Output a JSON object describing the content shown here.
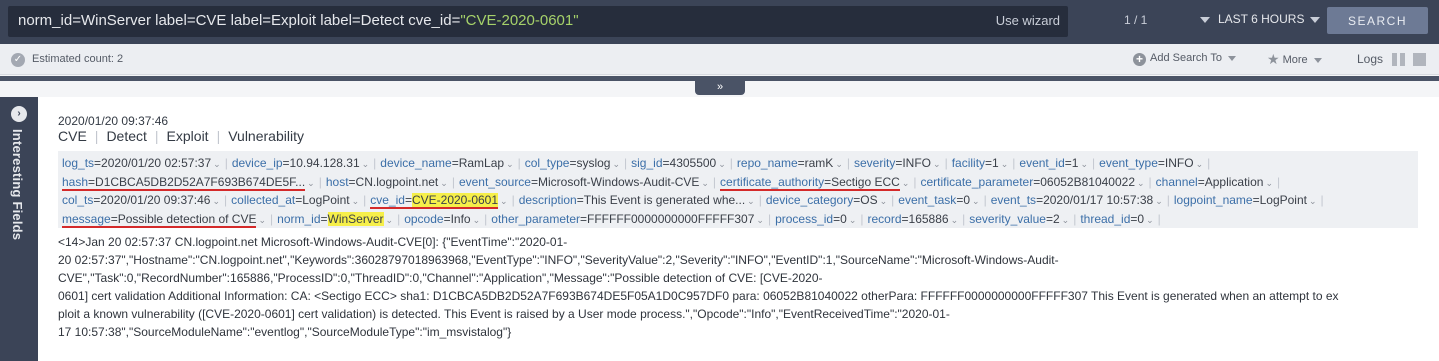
{
  "search": {
    "query_prefix": "norm_id=WinServer label=CVE label=Exploit label=Detect cve_id=",
    "query_value": "\"CVE-2020-0601\"",
    "use_wizard": "Use wizard",
    "pager": "1 / 1",
    "time_range": "LAST 6 HOURS",
    "search_button": "SEARCH"
  },
  "subbar": {
    "estimated": "Estimated count: 2",
    "add_search_to": "Add Search To",
    "more": "More",
    "logs": "Logs"
  },
  "side_panel": {
    "label": "Interesting Fields"
  },
  "entry": {
    "timestamp": "2020/01/20 09:37:46",
    "tags": [
      "CVE",
      "Detect",
      "Exploit",
      "Vulnerability"
    ],
    "fields": [
      [
        {
          "k": "log_ts",
          "v": "2020/01/20 02:57:37"
        },
        {
          "k": "device_ip",
          "v": "10.94.128.31"
        },
        {
          "k": "device_name",
          "v": "RamLap"
        },
        {
          "k": "col_type",
          "v": "syslog"
        },
        {
          "k": "sig_id",
          "v": "4305500"
        },
        {
          "k": "repo_name",
          "v": "ramK"
        },
        {
          "k": "severity",
          "v": "INFO"
        },
        {
          "k": "facility",
          "v": "1"
        },
        {
          "k": "event_id",
          "v": "1"
        },
        {
          "k": "event_type",
          "v": "INFO"
        }
      ],
      [
        {
          "k": "hash",
          "v": "D1CBCA5DB2D52A7F693B674DE5F...",
          "underline": true
        },
        {
          "k": "host",
          "v": "CN.logpoint.net"
        },
        {
          "k": "event_source",
          "v": "Microsoft-Windows-Audit-CVE"
        },
        {
          "k": "certificate_authority",
          "v": "Sectigo ECC",
          "underline": true
        },
        {
          "k": "certificate_parameter",
          "v": "06052B81040022"
        },
        {
          "k": "channel",
          "v": "Application"
        }
      ],
      [
        {
          "k": "col_ts",
          "v": "2020/01/20 09:37:46"
        },
        {
          "k": "collected_at",
          "v": "LogPoint"
        },
        {
          "k": "cve_id",
          "v": "CVE-2020-0601",
          "underline": true,
          "highlight": true
        },
        {
          "k": "description",
          "v": "This Event is generated whe..."
        },
        {
          "k": "device_category",
          "v": "OS"
        },
        {
          "k": "event_task",
          "v": "0"
        },
        {
          "k": "event_ts",
          "v": "2020/01/17 10:57:38"
        },
        {
          "k": "logpoint_name",
          "v": "LogPoint"
        }
      ],
      [
        {
          "k": "message",
          "v": "Possible detection of CVE",
          "underline": true
        },
        {
          "k": "norm_id",
          "v": "WinServer",
          "highlight": true
        },
        {
          "k": "opcode",
          "v": "Info"
        },
        {
          "k": "other_parameter",
          "v": "FFFFFF0000000000FFFFF307"
        },
        {
          "k": "process_id",
          "v": "0"
        },
        {
          "k": "record",
          "v": "165886"
        },
        {
          "k": "severity_value",
          "v": "2"
        },
        {
          "k": "thread_id",
          "v": "0"
        }
      ]
    ],
    "raw_lines": [
      "<14>Jan 20 02:57:37 CN.logpoint.net Microsoft-Windows-Audit-CVE[0]: {\"EventTime\":\"2020-01-",
      "20 02:57:37\",\"Hostname\":\"CN.logpoint.net\",\"Keywords\":36028797018963968,\"EventType\":\"INFO\",\"SeverityValue\":2,\"Severity\":\"INFO\",\"EventID\":1,\"SourceName\":\"Microsoft-Windows-Audit-",
      "CVE\",\"Task\":0,\"RecordNumber\":165886,\"ProcessID\":0,\"ThreadID\":0,\"Channel\":\"Application\",\"Message\":\"Possible detection of CVE: [CVE-2020-",
      "0601] cert validation Additional Information: CA: <Sectigo ECC> sha1: D1CBCA5DB2D52A7F693B674DE5F05A1D0C957DF0 para: 06052B81040022 otherPara: FFFFFF0000000000FFFFF307 This Event is generated when an attempt to ex",
      "ploit a known vulnerability ([CVE-2020-0601] cert validation) is detected. This Event is raised by a User mode process.\",\"Opcode\":\"Info\",\"EventReceivedTime\":\"2020-01-",
      "17 10:57:38\",\"SourceModuleName\":\"eventlog\",\"SourceModuleType\":\"im_msvistalog\"}"
    ]
  }
}
